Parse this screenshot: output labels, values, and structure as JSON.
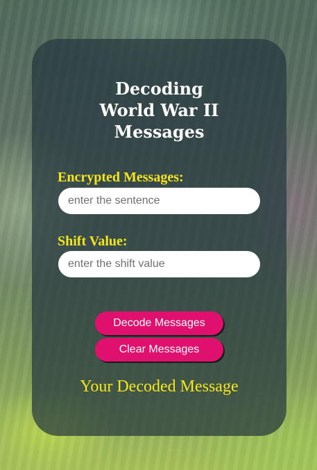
{
  "card": {
    "title_lines": [
      "Decoding",
      "World War II",
      "Messages"
    ]
  },
  "encrypted": {
    "label": "Encrypted Messages:",
    "placeholder": "enter the sentence",
    "value": ""
  },
  "shift": {
    "label": "Shift Value:",
    "placeholder": "enter the shift value",
    "value": ""
  },
  "buttons": {
    "decode_label": "Decode Messages",
    "clear_label": "Clear Messages"
  },
  "result": {
    "text": "Your Decoded Message"
  },
  "colors": {
    "accent_yellow": "#f5e51d",
    "button_pink": "#e0106e",
    "card_bg": "#26383e"
  }
}
